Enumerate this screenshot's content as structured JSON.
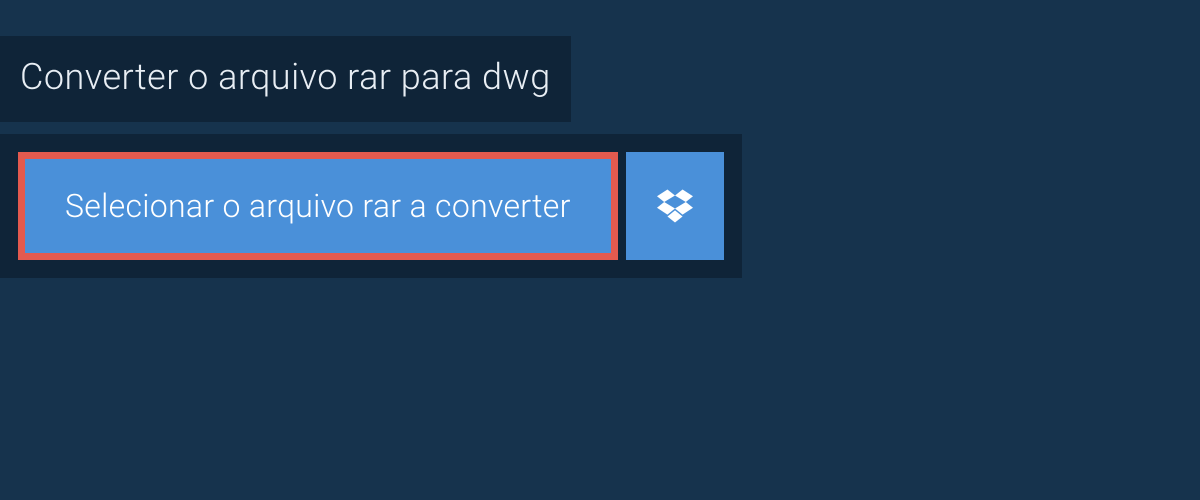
{
  "header": {
    "title": "Converter o arquivo rar para dwg"
  },
  "actions": {
    "select_file_label": "Selecionar o arquivo rar a converter",
    "dropbox_icon": "dropbox-icon"
  },
  "colors": {
    "background": "#16334d",
    "panel": "#0f2438",
    "button": "#4a90d9",
    "highlight_border": "#e35a4f"
  }
}
